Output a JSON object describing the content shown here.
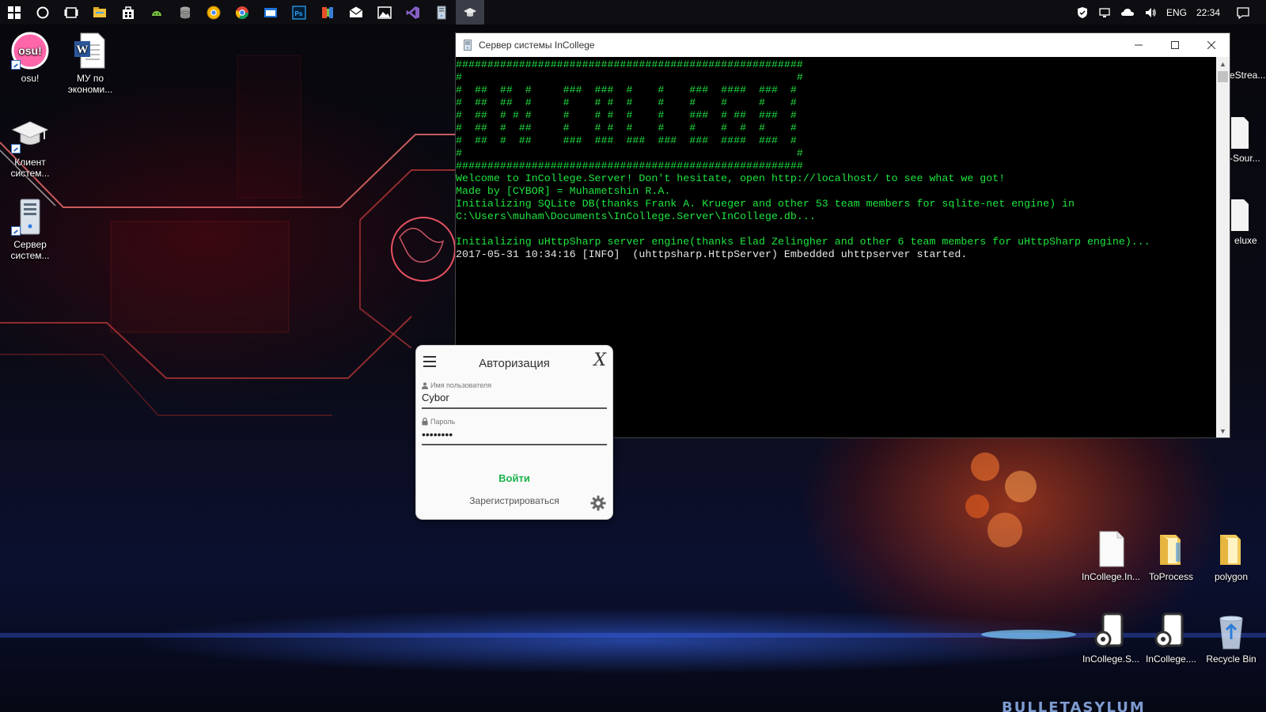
{
  "taskbar": {
    "apps": [
      {
        "icon": "windows-start-icon",
        "active": false
      },
      {
        "icon": "cortana-search-icon",
        "active": false
      },
      {
        "icon": "task-view-icon",
        "active": false
      },
      {
        "icon": "file-explorer-icon",
        "active": false
      },
      {
        "icon": "store-icon",
        "active": false
      },
      {
        "icon": "android-studio-icon",
        "active": false
      },
      {
        "icon": "database-icon",
        "active": false
      },
      {
        "icon": "chrome-canary-icon",
        "active": false
      },
      {
        "icon": "chrome-icon",
        "active": false
      },
      {
        "icon": "app-window-icon",
        "active": false
      },
      {
        "icon": "photoshop-icon",
        "active": false
      },
      {
        "icon": "office-icon",
        "active": false
      },
      {
        "icon": "mail-icon",
        "active": false
      },
      {
        "icon": "photos-icon",
        "active": false
      },
      {
        "icon": "visual-studio-icon",
        "active": false
      },
      {
        "icon": "server-app-icon",
        "active": false
      },
      {
        "icon": "graduation-cap-app-icon",
        "active": true
      }
    ],
    "tray": {
      "language": "ENG",
      "time": "22:34"
    }
  },
  "desktop": {
    "left_icons": [
      {
        "name": "osu-shortcut",
        "label": "osu!",
        "badge": "osu!"
      },
      {
        "name": "word-document",
        "label": "МУ по экономи..."
      },
      {
        "name": "client-shortcut",
        "label": "Клиент систем..."
      },
      {
        "name": "server-shortcut",
        "label": "Сервер систем..."
      }
    ],
    "right_partial_labels": [
      "eStrea...",
      "-Sour...",
      "eluxe"
    ],
    "bottom_icons": [
      {
        "label": "InCollege.In..."
      },
      {
        "label": "ToProcess"
      },
      {
        "label": "polygon"
      },
      {
        "label": "InCollege.S..."
      },
      {
        "label": "InCollege...."
      },
      {
        "label": "Recycle Bin"
      }
    ],
    "wallpaper_brand": "BULLETASYLUM"
  },
  "console": {
    "title": "Сервер системы InCollege",
    "lines": [
      {
        "text": "#######################################################",
        "color": "green"
      },
      {
        "text": "#                                                     #",
        "color": "green"
      },
      {
        "text": "#  ##  ##  #     ###  ###  #    #    ###  ####  ###  #",
        "color": "green"
      },
      {
        "text": "#  ##  ##  #     #    # #  #    #    #    #     #    #",
        "color": "green"
      },
      {
        "text": "#  ##  # # #     #    # #  #    #    ###  # ##  ###  #",
        "color": "green"
      },
      {
        "text": "#  ##  #  ##     #    # #  #    #    #    #  #  #    #",
        "color": "green"
      },
      {
        "text": "#  ##  #  ##     ###  ###  ###  ###  ###  ####  ###  #",
        "color": "green"
      },
      {
        "text": "#                                                     #",
        "color": "green"
      },
      {
        "text": "#######################################################",
        "color": "green"
      },
      {
        "text": "Welcome to InCollege.Server! Don't hesitate, open http://localhost/ to see what we got!",
        "color": "green"
      },
      {
        "text": "Made by [CYBOR] = Muhametshin R.A.",
        "color": "green"
      },
      {
        "text": "Initializing SQLite DB(thanks Frank A. Krueger and other 53 team members for sqlite-net engine) in",
        "color": "green"
      },
      {
        "text": "C:\\Users\\muham\\Documents\\InCollege.Server\\InCollege.db...",
        "color": "green"
      },
      {
        "text": "",
        "color": "green"
      },
      {
        "text": "Initializing uHttpSharp server engine(thanks Elad Zelingher and other 6 team members for uHttpSharp engine)...",
        "color": "green"
      },
      {
        "text": "2017-05-31 10:34:16 [INFO]  (uhttpsharp.HttpServer) Embedded uhttpserver started.",
        "color": "white"
      }
    ],
    "colors": {
      "green": "#1ee63f",
      "white": "#e8e8e8",
      "background": "#000000"
    }
  },
  "login": {
    "title": "Авторизация",
    "close_glyph": "X",
    "username_label": "Имя пользователя",
    "username_value": "Cybor",
    "password_label": "Пароль",
    "password_value": "••••••••",
    "submit_label": "Войти",
    "register_label": "Зарегистрироваться",
    "accent": "#1bb34a"
  }
}
